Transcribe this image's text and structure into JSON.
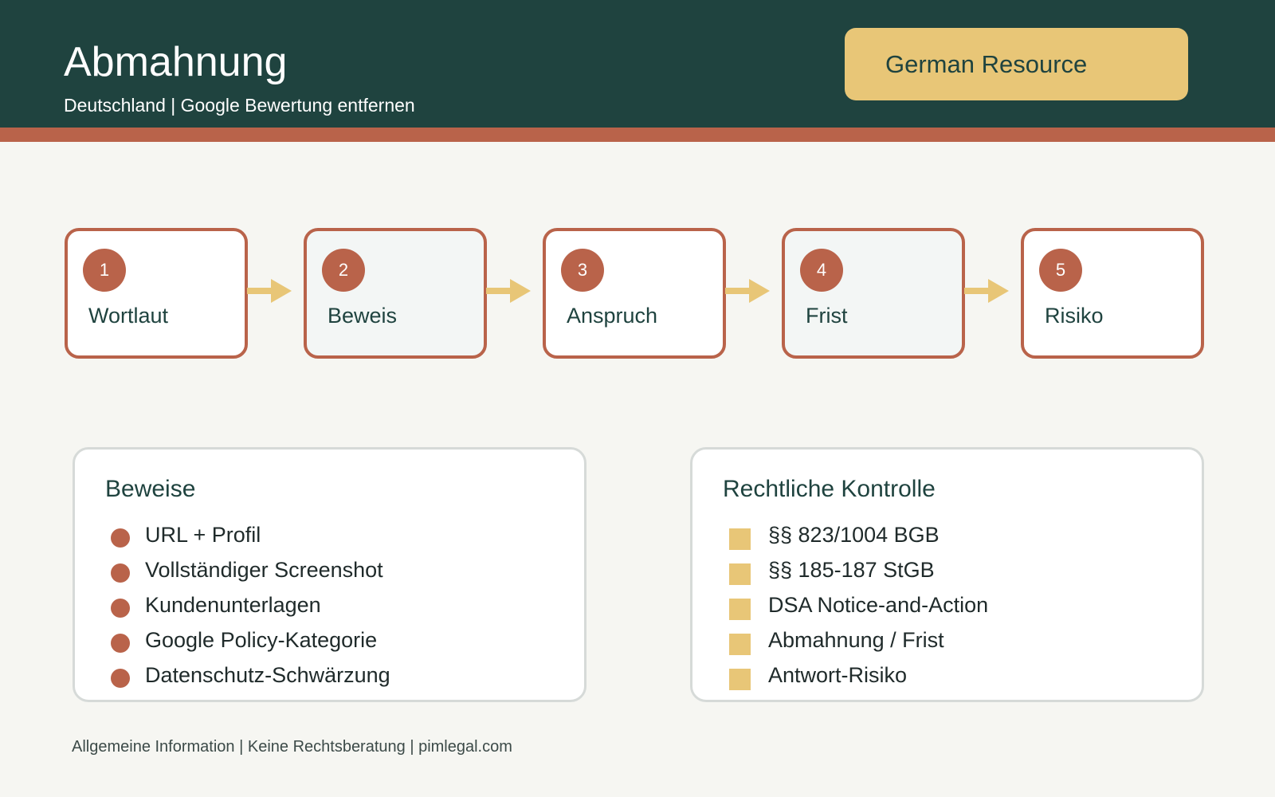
{
  "header": {
    "title": "Abmahnung",
    "subtitle": "Deutschland | Google Bewertung entfernen",
    "badge": "German Resource"
  },
  "steps": [
    {
      "num": "1",
      "label": "Wortlaut"
    },
    {
      "num": "2",
      "label": "Beweis"
    },
    {
      "num": "3",
      "label": "Anspruch"
    },
    {
      "num": "4",
      "label": "Frist"
    },
    {
      "num": "5",
      "label": "Risiko"
    }
  ],
  "evidence": {
    "title": "Beweise",
    "items": [
      "URL + Profil",
      "Vollständiger Screenshot",
      "Kundenunterlagen",
      "Google Policy-Kategorie",
      "Datenschutz-Schwärzung"
    ]
  },
  "legal": {
    "title": "Rechtliche Kontrolle",
    "items": [
      "§§ 823/1004 BGB",
      "§§ 185-187 StGB",
      "DSA Notice-and-Action",
      "Abmahnung / Frist",
      "Antwort-Risiko"
    ]
  },
  "footer": "Allgemeine Information | Keine Rechtsberatung | pimlegal.com",
  "colors": {
    "primary": "#1f433f",
    "accent": "#b9634a",
    "highlight": "#e8c677",
    "background": "#f6f6f2"
  }
}
